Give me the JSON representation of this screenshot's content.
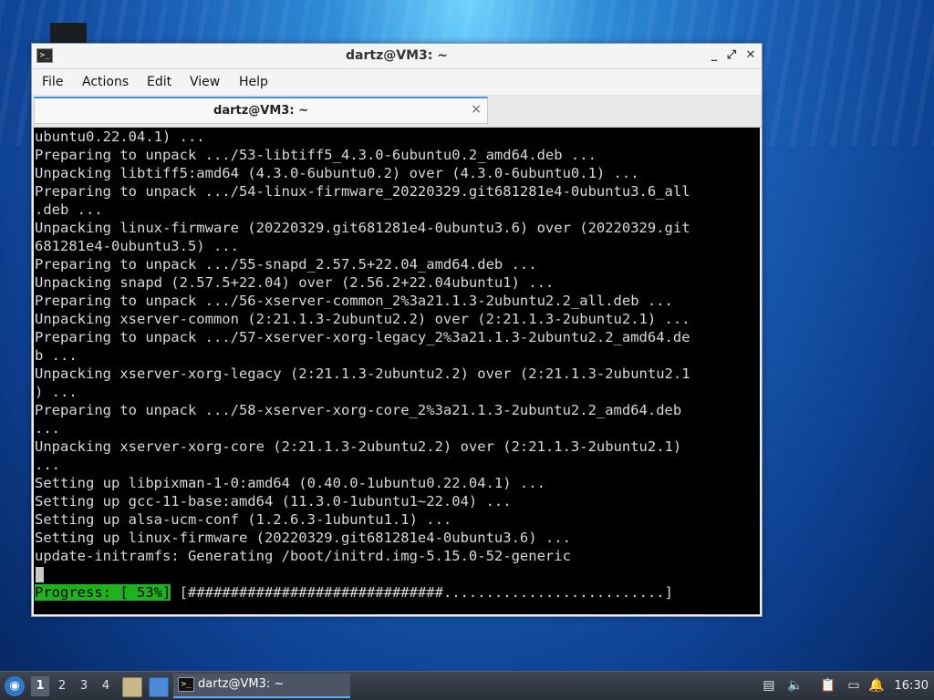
{
  "window": {
    "title": "dartz@VM3: ~",
    "controls": {
      "minimize": "_",
      "maximize": "⤢",
      "close": "✕"
    }
  },
  "menu": {
    "items": [
      "File",
      "Actions",
      "Edit",
      "View",
      "Help"
    ]
  },
  "tab": {
    "label": "dartz@VM3: ~",
    "close": "×"
  },
  "terminal": {
    "lines": [
      "ubuntu0.22.04.1) ...",
      "Preparing to unpack .../53-libtiff5_4.3.0-6ubuntu0.2_amd64.deb ...",
      "Unpacking libtiff5:amd64 (4.3.0-6ubuntu0.2) over (4.3.0-6ubuntu0.1) ...",
      "Preparing to unpack .../54-linux-firmware_20220329.git681281e4-0ubuntu3.6_all",
      ".deb ...",
      "Unpacking linux-firmware (20220329.git681281e4-0ubuntu3.6) over (20220329.git",
      "681281e4-0ubuntu3.5) ...",
      "Preparing to unpack .../55-snapd_2.57.5+22.04_amd64.deb ...",
      "Unpacking snapd (2.57.5+22.04) over (2.56.2+22.04ubuntu1) ...",
      "Preparing to unpack .../56-xserver-common_2%3a21.1.3-2ubuntu2.2_all.deb ...",
      "Unpacking xserver-common (2:21.1.3-2ubuntu2.2) over (2:21.1.3-2ubuntu2.1) ...",
      "Preparing to unpack .../57-xserver-xorg-legacy_2%3a21.1.3-2ubuntu2.2_amd64.de",
      "b ...",
      "Unpacking xserver-xorg-legacy (2:21.1.3-2ubuntu2.2) over (2:21.1.3-2ubuntu2.1",
      ") ...",
      "Preparing to unpack .../58-xserver-xorg-core_2%3a21.1.3-2ubuntu2.2_amd64.deb",
      "...",
      "Unpacking xserver-xorg-core (2:21.1.3-2ubuntu2.2) over (2:21.1.3-2ubuntu2.1)",
      "...",
      "Setting up libpixman-1-0:amd64 (0.40.0-1ubuntu0.22.04.1) ...",
      "Setting up gcc-11-base:amd64 (11.3.0-1ubuntu1~22.04) ...",
      "Setting up alsa-ucm-conf (1.2.6.3-1ubuntu1.1) ...",
      "Setting up linux-firmware (20220329.git681281e4-0ubuntu3.6) ...",
      "update-initramfs: Generating /boot/initrd.img-5.15.0-52-generic"
    ],
    "progress": {
      "label": "Progress: [ 53%]",
      "bar": "[##############################..........................]",
      "percent": 53
    }
  },
  "taskbar": {
    "start_icon": "start-menu-icon",
    "workspaces": [
      "1",
      "2",
      "3",
      "4"
    ],
    "active_workspace": "1",
    "task_label": "dartz@VM3: ~",
    "clock": "16:30"
  },
  "colors": {
    "progress_green": "#1eb21e",
    "terminal_bg": "#000000",
    "accent": "#4a90d9"
  }
}
